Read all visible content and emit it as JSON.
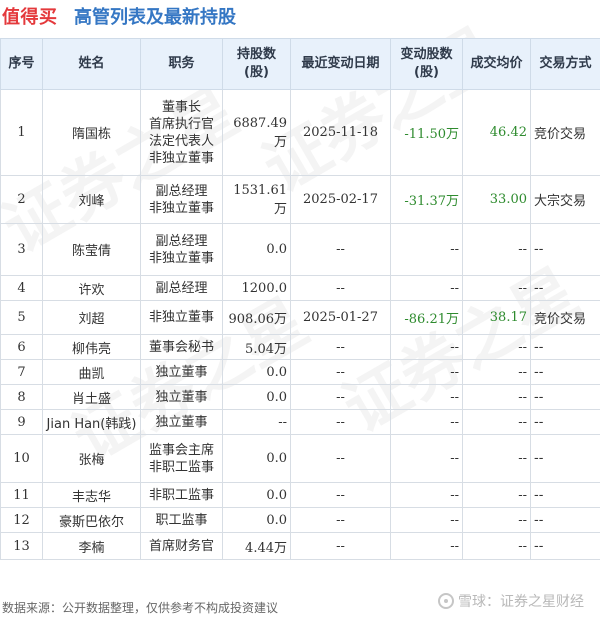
{
  "header": {
    "brand": "值得买",
    "title": "高管列表及最新持股"
  },
  "table": {
    "columns": [
      "序号",
      "姓名",
      "职务",
      "持股数\n(股)",
      "最近变动日期",
      "变动股数\n(股)",
      "成交均价",
      "交易方式"
    ],
    "rows": [
      {
        "no": "1",
        "name": "隋国栋",
        "roles": [
          "董事长",
          "首席执行官",
          "法定代表人",
          "非独立董事"
        ],
        "shares": "6887.49万",
        "date": "2025-11-18",
        "change": "-11.50万",
        "price": "46.42",
        "method": "竞价交易"
      },
      {
        "no": "2",
        "name": "刘峰",
        "roles": [
          "副总经理",
          "非独立董事"
        ],
        "shares": "1531.61万",
        "date": "2025-02-17",
        "change": "-31.37万",
        "price": "33.00",
        "method": "大宗交易"
      },
      {
        "no": "3",
        "name": "陈莹倩",
        "roles": [
          "副总经理",
          "非独立董事"
        ],
        "shares": "0.0",
        "date": "--",
        "change": "--",
        "price": "--",
        "method": "--"
      },
      {
        "no": "4",
        "name": "许欢",
        "roles": [
          "副总经理"
        ],
        "shares": "1200.0",
        "date": "--",
        "change": "--",
        "price": "--",
        "method": "--"
      },
      {
        "no": "5",
        "name": "刘超",
        "roles": [
          "非独立董事"
        ],
        "shares": "908.06万",
        "date": "2025-01-27",
        "change": "-86.21万",
        "price": "38.17",
        "method": "竞价交易"
      },
      {
        "no": "6",
        "name": "柳伟亮",
        "roles": [
          "董事会秘书"
        ],
        "shares": "5.04万",
        "date": "--",
        "change": "--",
        "price": "--",
        "method": "--"
      },
      {
        "no": "7",
        "name": "曲凯",
        "roles": [
          "独立董事"
        ],
        "shares": "0.0",
        "date": "--",
        "change": "--",
        "price": "--",
        "method": "--"
      },
      {
        "no": "8",
        "name": "肖土盛",
        "roles": [
          "独立董事"
        ],
        "shares": "0.0",
        "date": "--",
        "change": "--",
        "price": "--",
        "method": "--"
      },
      {
        "no": "9",
        "name": "Jian Han(韩践)",
        "roles": [
          "独立董事"
        ],
        "shares": "--",
        "date": "--",
        "change": "--",
        "price": "--",
        "method": "--"
      },
      {
        "no": "10",
        "name": "张梅",
        "roles": [
          "监事会主席",
          "非职工监事"
        ],
        "shares": "0.0",
        "date": "--",
        "change": "--",
        "price": "--",
        "method": "--"
      },
      {
        "no": "11",
        "name": "丰志华",
        "roles": [
          "非职工监事"
        ],
        "shares": "0.0",
        "date": "--",
        "change": "--",
        "price": "--",
        "method": "--"
      },
      {
        "no": "12",
        "name": "豪斯巴依尔",
        "roles": [
          "职工监事"
        ],
        "shares": "0.0",
        "date": "--",
        "change": "--",
        "price": "--",
        "method": "--"
      },
      {
        "no": "13",
        "name": "李楠",
        "roles": [
          "首席财务官"
        ],
        "shares": "4.44万",
        "date": "--",
        "change": "--",
        "price": "--",
        "method": "--"
      }
    ]
  },
  "footer": {
    "source": "数据来源：公开数据整理，仅供参考不构成投资建议",
    "logo_text": "雪球：证券之星财经"
  },
  "watermark": {
    "text": "证券之星"
  },
  "colors": {
    "brand": "#e4393c",
    "title": "#3577c4",
    "header_bg": "#e8f1fb",
    "change": "#2e8b2e"
  }
}
